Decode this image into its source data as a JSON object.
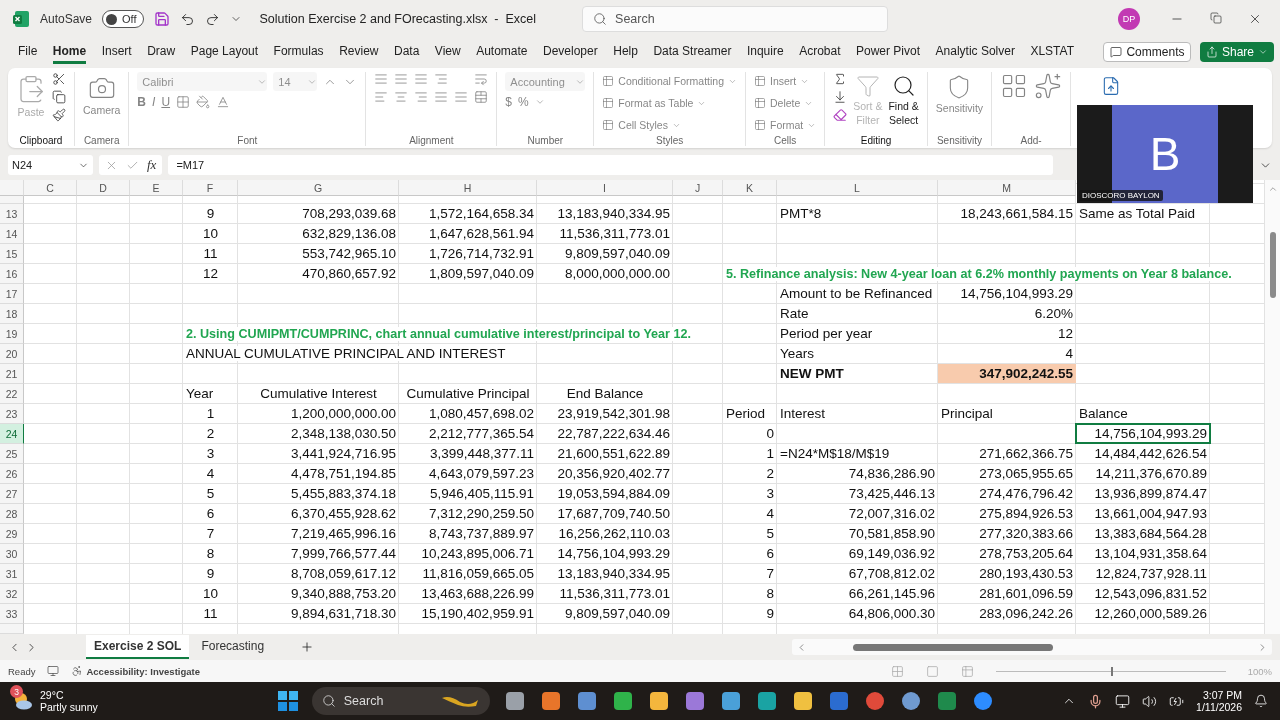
{
  "title_bar": {
    "autosave_label": "AutoSave",
    "autosave": {
      "label": "Off",
      "on": false
    },
    "title": "Solution Exercise 2 and FOrecasting.xlsx  -  Excel",
    "search_placeholder": "Search",
    "user_initials": "DP"
  },
  "menu_tabs": [
    {
      "label": "File",
      "selected": false
    },
    {
      "label": "Home",
      "selected": true
    },
    {
      "label": "Insert",
      "selected": false
    },
    {
      "label": "Draw",
      "selected": false
    },
    {
      "label": "Page Layout",
      "selected": false
    },
    {
      "label": "Formulas",
      "selected": false
    },
    {
      "label": "Review",
      "selected": false
    },
    {
      "label": "Data",
      "selected": false
    },
    {
      "label": "View",
      "selected": false
    },
    {
      "label": "Automate",
      "selected": false
    },
    {
      "label": "Developer",
      "selected": false
    },
    {
      "label": "Help",
      "selected": false
    },
    {
      "label": "Data Streamer",
      "selected": false
    },
    {
      "label": "Inquire",
      "selected": false
    },
    {
      "label": "Acrobat",
      "selected": false
    },
    {
      "label": "Power Pivot",
      "selected": false
    },
    {
      "label": "Analytic Solver",
      "selected": false
    },
    {
      "label": "XLSTAT",
      "selected": false
    }
  ],
  "comments_button": "Comments",
  "share_button": "Share",
  "ribbon_groups": [
    {
      "kind": "clipboard",
      "label": "Clipboard",
      "disabled": false,
      "button": "Paste"
    },
    {
      "kind": "camera",
      "label": "Camera",
      "disabled": true,
      "button": "Camera"
    },
    {
      "kind": "font",
      "label": "Font",
      "disabled": true,
      "font_name": "Calibri",
      "font_size": "14",
      "bold": "B",
      "italic": "I",
      "underline": "U"
    },
    {
      "kind": "alignment",
      "label": "Alignment",
      "disabled": true
    },
    {
      "kind": "number",
      "label": "Number",
      "disabled": true,
      "format": "Accounting",
      "currency": "$",
      "percent": "%"
    },
    {
      "kind": "list",
      "label": "Styles",
      "disabled": true,
      "items": [
        "Conditional Formatting",
        "Format as Table",
        "Cell Styles"
      ]
    },
    {
      "kind": "list",
      "label": "Cells",
      "disabled": true,
      "items": [
        "Insert",
        "Delete",
        "Format"
      ]
    },
    {
      "kind": "editing",
      "label": "Editing",
      "disabled": false,
      "sort": "Sort &",
      "sort2": "Filter",
      "find": "Find &",
      "find2": "Select"
    },
    {
      "kind": "big",
      "label": "Sensitivity",
      "disabled": true,
      "button": "Sensitivity"
    },
    {
      "kind": "addins",
      "label": "Add-",
      "disabled": true
    }
  ],
  "formula_bar": {
    "name_box": "N24",
    "fx_label": "fx",
    "formula": "=M17"
  },
  "columns": [
    "C",
    "D",
    "E",
    "F",
    "G",
    "H",
    "I",
    "J",
    "K",
    "L",
    "M"
  ],
  "rows": [
    {
      "number": "13",
      "cells": {
        "f": {
          "text": "9",
          "kind": "center",
          "selected": false
        },
        "g": {
          "text": "708,293,039.68",
          "kind": "num",
          "selected": false
        },
        "h": {
          "text": "1,572,164,658.34",
          "kind": "num",
          "selected": false
        },
        "i": {
          "text": "13,183,940,334.95",
          "kind": "num",
          "selected": false
        },
        "l": {
          "text": "PMT*8",
          "kind": "text",
          "selected": false
        },
        "m": {
          "text": "18,243,661,584.15",
          "kind": "num",
          "selected": false
        },
        "n": {
          "text": "Same as Total Paid",
          "kind": "text",
          "selected": false
        }
      }
    },
    {
      "number": "14",
      "cells": {
        "f": {
          "text": "10",
          "kind": "center",
          "selected": false
        },
        "g": {
          "text": "632,829,136.08",
          "kind": "num",
          "selected": false
        },
        "h": {
          "text": "1,647,628,561.94",
          "kind": "num",
          "selected": false
        },
        "i": {
          "text": "11,536,311,773.01",
          "kind": "num",
          "selected": false
        }
      }
    },
    {
      "number": "15",
      "cells": {
        "f": {
          "text": "11",
          "kind": "center",
          "selected": false
        },
        "g": {
          "text": "553,742,965.10",
          "kind": "num",
          "selected": false
        },
        "h": {
          "text": "1,726,714,732.91",
          "kind": "num",
          "selected": false
        },
        "i": {
          "text": "9,809,597,040.09",
          "kind": "num",
          "selected": false
        }
      }
    },
    {
      "number": "16",
      "cells": {
        "f": {
          "text": "12",
          "kind": "center",
          "selected": false
        },
        "g": {
          "text": "470,860,657.92",
          "kind": "num",
          "selected": false
        },
        "h": {
          "text": "1,809,597,040.09",
          "kind": "num",
          "selected": false
        },
        "i": {
          "text": "8,000,000,000.00",
          "kind": "num",
          "selected": false
        },
        "k": {
          "text": "5. Refinance analysis: New 4-year loan at 6.2% monthly payments on Year 8 balance.",
          "kind": "heading",
          "selected": false
        }
      }
    },
    {
      "number": "17",
      "cells": {
        "l": {
          "text": "Amount to be Refinanced",
          "kind": "text",
          "selected": false
        },
        "m": {
          "text": "14,756,104,993.29",
          "kind": "num",
          "selected": false
        }
      }
    },
    {
      "number": "18",
      "cells": {
        "l": {
          "text": "Rate",
          "kind": "text",
          "selected": false
        },
        "m": {
          "text": "6.20%",
          "kind": "num",
          "selected": false
        }
      }
    },
    {
      "number": "19",
      "cells": {
        "f": {
          "text": "2. Using CUMIPMT/CUMPRINC, chart annual cumulative interest/principal to Year 12.",
          "kind": "heading",
          "selected": false
        },
        "l": {
          "text": "Period per year",
          "kind": "text",
          "selected": false
        },
        "m": {
          "text": "12",
          "kind": "num",
          "selected": false
        }
      }
    },
    {
      "number": "20",
      "cells": {
        "f": {
          "text": "ANNUAL CUMULATIVE PRINCIPAL AND INTEREST",
          "kind": "text",
          "selected": false
        },
        "l": {
          "text": "Years",
          "kind": "text",
          "selected": false
        },
        "m": {
          "text": "4",
          "kind": "num",
          "selected": false
        }
      }
    },
    {
      "number": "21",
      "cells": {
        "l": {
          "text": "NEW PMT",
          "kind": "bold",
          "selected": false
        },
        "m": {
          "text": "347,902,242.55",
          "kind": "highlight",
          "selected": false
        }
      }
    },
    {
      "number": "22",
      "cells": {
        "f": {
          "text": "Year",
          "kind": "text",
          "selected": false
        },
        "g": {
          "text": "Cumulative Interest",
          "kind": "header",
          "selected": false
        },
        "h": {
          "text": "Cumulative Principal",
          "kind": "header",
          "selected": false
        },
        "i": {
          "text": "End Balance",
          "kind": "header",
          "selected": false
        }
      }
    },
    {
      "number": "23",
      "cells": {
        "f": {
          "text": "1",
          "kind": "center",
          "selected": false
        },
        "g": {
          "text": "1,200,000,000.00",
          "kind": "num",
          "selected": false
        },
        "h": {
          "text": "1,080,457,698.02",
          "kind": "num",
          "selected": false
        },
        "i": {
          "text": "23,919,542,301.98",
          "kind": "num",
          "selected": false
        },
        "k": {
          "text": "Period",
          "kind": "text",
          "selected": false
        },
        "l": {
          "text": "Interest",
          "kind": "text",
          "selected": false
        },
        "m": {
          "text": "Principal",
          "kind": "text",
          "selected": false
        },
        "n": {
          "text": "Balance",
          "kind": "text",
          "selected": false
        }
      }
    },
    {
      "number": "24",
      "cells": {
        "f": {
          "text": "2",
          "kind": "center",
          "selected": false
        },
        "g": {
          "text": "2,348,138,030.50",
          "kind": "num",
          "selected": false
        },
        "h": {
          "text": "2,212,777,365.54",
          "kind": "num",
          "selected": false
        },
        "i": {
          "text": "22,787,222,634.46",
          "kind": "num",
          "selected": false
        },
        "k": {
          "text": "0",
          "kind": "num",
          "selected": false
        },
        "n": {
          "text": "14,756,104,993.29",
          "kind": "num",
          "selected": true
        }
      }
    },
    {
      "number": "25",
      "cells": {
        "f": {
          "text": "3",
          "kind": "center",
          "selected": false
        },
        "g": {
          "text": "3,441,924,716.95",
          "kind": "num",
          "selected": false
        },
        "h": {
          "text": "3,399,448,377.11",
          "kind": "num",
          "selected": false
        },
        "i": {
          "text": "21,600,551,622.89",
          "kind": "num",
          "selected": false
        },
        "k": {
          "text": "1",
          "kind": "num",
          "selected": false
        },
        "l": {
          "text": "=N24*M$18/M$19",
          "kind": "text",
          "selected": false
        },
        "m": {
          "text": "271,662,366.75",
          "kind": "num",
          "selected": false
        },
        "n": {
          "text": "14,484,442,626.54",
          "kind": "num",
          "selected": false
        }
      }
    },
    {
      "number": "26",
      "cells": {
        "f": {
          "text": "4",
          "kind": "center",
          "selected": false
        },
        "g": {
          "text": "4,478,751,194.85",
          "kind": "num",
          "selected": false
        },
        "h": {
          "text": "4,643,079,597.23",
          "kind": "num",
          "selected": false
        },
        "i": {
          "text": "20,356,920,402.77",
          "kind": "num",
          "selected": false
        },
        "k": {
          "text": "2",
          "kind": "num",
          "selected": false
        },
        "l": {
          "text": "74,836,286.90",
          "kind": "num",
          "selected": false
        },
        "m": {
          "text": "273,065,955.65",
          "kind": "num",
          "selected": false
        },
        "n": {
          "text": "14,211,376,670.89",
          "kind": "num",
          "selected": false
        }
      }
    },
    {
      "number": "27",
      "cells": {
        "f": {
          "text": "5",
          "kind": "center",
          "selected": false
        },
        "g": {
          "text": "5,455,883,374.18",
          "kind": "num",
          "selected": false
        },
        "h": {
          "text": "5,946,405,115.91",
          "kind": "num",
          "selected": false
        },
        "i": {
          "text": "19,053,594,884.09",
          "kind": "num",
          "selected": false
        },
        "k": {
          "text": "3",
          "kind": "num",
          "selected": false
        },
        "l": {
          "text": "73,425,446.13",
          "kind": "num",
          "selected": false
        },
        "m": {
          "text": "274,476,796.42",
          "kind": "num",
          "selected": false
        },
        "n": {
          "text": "13,936,899,874.47",
          "kind": "num",
          "selected": false
        }
      }
    },
    {
      "number": "28",
      "cells": {
        "f": {
          "text": "6",
          "kind": "center",
          "selected": false
        },
        "g": {
          "text": "6,370,455,928.62",
          "kind": "num",
          "selected": false
        },
        "h": {
          "text": "7,312,290,259.50",
          "kind": "num",
          "selected": false
        },
        "i": {
          "text": "17,687,709,740.50",
          "kind": "num",
          "selected": false
        },
        "k": {
          "text": "4",
          "kind": "num",
          "selected": false
        },
        "l": {
          "text": "72,007,316.02",
          "kind": "num",
          "selected": false
        },
        "m": {
          "text": "275,894,926.53",
          "kind": "num",
          "selected": false
        },
        "n": {
          "text": "13,661,004,947.93",
          "kind": "num",
          "selected": false
        }
      }
    },
    {
      "number": "29",
      "cells": {
        "f": {
          "text": "7",
          "kind": "center",
          "selected": false
        },
        "g": {
          "text": "7,219,465,996.16",
          "kind": "num",
          "selected": false
        },
        "h": {
          "text": "8,743,737,889.97",
          "kind": "num",
          "selected": false
        },
        "i": {
          "text": "16,256,262,110.03",
          "kind": "num",
          "selected": false
        },
        "k": {
          "text": "5",
          "kind": "num",
          "selected": false
        },
        "l": {
          "text": "70,581,858.90",
          "kind": "num",
          "selected": false
        },
        "m": {
          "text": "277,320,383.66",
          "kind": "num",
          "selected": false
        },
        "n": {
          "text": "13,383,684,564.28",
          "kind": "num",
          "selected": false
        }
      }
    },
    {
      "number": "30",
      "cells": {
        "f": {
          "text": "8",
          "kind": "center",
          "selected": false
        },
        "g": {
          "text": "7,999,766,577.44",
          "kind": "num",
          "selected": false
        },
        "h": {
          "text": "10,243,895,006.71",
          "kind": "num",
          "selected": false
        },
        "i": {
          "text": "14,756,104,993.29",
          "kind": "num",
          "selected": false
        },
        "k": {
          "text": "6",
          "kind": "num",
          "selected": false
        },
        "l": {
          "text": "69,149,036.92",
          "kind": "num",
          "selected": false
        },
        "m": {
          "text": "278,753,205.64",
          "kind": "num",
          "selected": false
        },
        "n": {
          "text": "13,104,931,358.64",
          "kind": "num",
          "selected": false
        }
      }
    },
    {
      "number": "31",
      "cells": {
        "f": {
          "text": "9",
          "kind": "center",
          "selected": false
        },
        "g": {
          "text": "8,708,059,617.12",
          "kind": "num",
          "selected": false
        },
        "h": {
          "text": "11,816,059,665.05",
          "kind": "num",
          "selected": false
        },
        "i": {
          "text": "13,183,940,334.95",
          "kind": "num",
          "selected": false
        },
        "k": {
          "text": "7",
          "kind": "num",
          "selected": false
        },
        "l": {
          "text": "67,708,812.02",
          "kind": "num",
          "selected": false
        },
        "m": {
          "text": "280,193,430.53",
          "kind": "num",
          "selected": false
        },
        "n": {
          "text": "12,824,737,928.11",
          "kind": "num",
          "selected": false
        }
      }
    },
    {
      "number": "32",
      "cells": {
        "f": {
          "text": "10",
          "kind": "center",
          "selected": false
        },
        "g": {
          "text": "9,340,888,753.20",
          "kind": "num",
          "selected": false
        },
        "h": {
          "text": "13,463,688,226.99",
          "kind": "num",
          "selected": false
        },
        "i": {
          "text": "11,536,311,773.01",
          "kind": "num",
          "selected": false
        },
        "k": {
          "text": "8",
          "kind": "num",
          "selected": false
        },
        "l": {
          "text": "66,261,145.96",
          "kind": "num",
          "selected": false
        },
        "m": {
          "text": "281,601,096.59",
          "kind": "num",
          "selected": false
        },
        "n": {
          "text": "12,543,096,831.52",
          "kind": "num",
          "selected": false
        }
      }
    },
    {
      "number": "33",
      "cells": {
        "f": {
          "text": "11",
          "kind": "center",
          "selected": false
        },
        "g": {
          "text": "9,894,631,718.30",
          "kind": "num",
          "selected": false
        },
        "h": {
          "text": "15,190,402,959.91",
          "kind": "num",
          "selected": false
        },
        "i": {
          "text": "9,809,597,040.09",
          "kind": "num",
          "selected": false
        },
        "k": {
          "text": "9",
          "kind": "num",
          "selected": false
        },
        "l": {
          "text": "64,806,000.30",
          "kind": "num",
          "selected": false
        },
        "m": {
          "text": "283,096,242.26",
          "kind": "num",
          "selected": false
        },
        "n": {
          "text": "12,260,000,589.26",
          "kind": "num",
          "selected": false
        }
      }
    }
  ],
  "sheet_tabs": [
    {
      "label": "Exercise 2 SOL",
      "selected": true
    },
    {
      "label": "Forecasting",
      "selected": false
    }
  ],
  "status_bar": {
    "ready": "Ready",
    "accessibility": "Accessibility: Investigate",
    "zoom_slider": {
      "level": 0.5
    },
    "zoom": "100%"
  },
  "video_tile": {
    "initial": "B",
    "name": "DIOSCORO BAYLON"
  },
  "taskbar": {
    "weather_badge": "3",
    "temperature": "29°C",
    "weather": "Partly sunny",
    "search": "Search",
    "time": "3:07 PM",
    "date": "1/11/2026"
  }
}
